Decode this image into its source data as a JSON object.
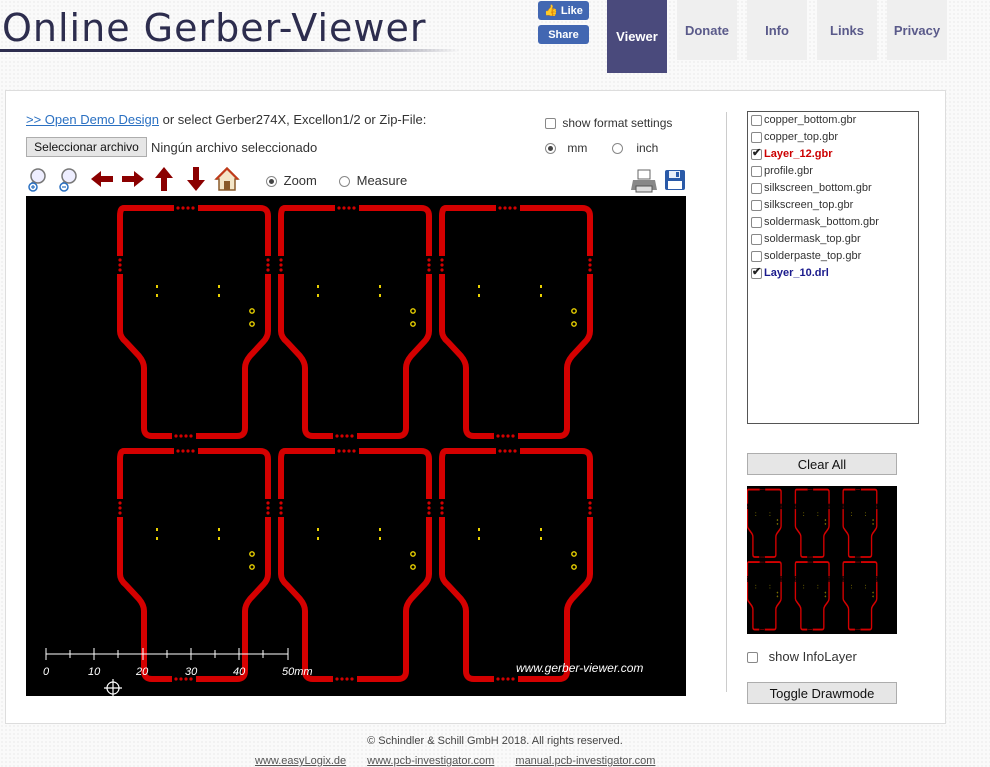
{
  "header": {
    "logo_text": "Online Gerber-Viewer",
    "fb_like": "Like",
    "fb_share": "Share",
    "tabs": [
      "Viewer",
      "Donate",
      "Info",
      "Links",
      "Privacy"
    ]
  },
  "controls": {
    "demo_link": ">> Open Demo Design",
    "select_text": "or select Gerber274X, Excellon1/2 or Zip-File:",
    "file_button": "Seleccionar archivo",
    "file_status": "Ningún archivo seleccionado",
    "show_format": "show format settings",
    "unit_mm": "mm",
    "unit_inch": "inch",
    "mode_zoom": "Zoom",
    "mode_measure": "Measure"
  },
  "canvas": {
    "watermark": "www.gerber-viewer.com",
    "scale_labels": [
      "0",
      "10",
      "20",
      "30",
      "40",
      "50mm"
    ]
  },
  "layers": [
    {
      "name": "copper_bottom.gbr",
      "checked": false
    },
    {
      "name": "copper_top.gbr",
      "checked": false
    },
    {
      "name": "Layer_12.gbr",
      "checked": true
    },
    {
      "name": "profile.gbr",
      "checked": false
    },
    {
      "name": "silkscreen_bottom.gbr",
      "checked": false
    },
    {
      "name": "silkscreen_top.gbr",
      "checked": false
    },
    {
      "name": "soldermask_bottom.gbr",
      "checked": false
    },
    {
      "name": "soldermask_top.gbr",
      "checked": false
    },
    {
      "name": "solderpaste_top.gbr",
      "checked": false
    },
    {
      "name": "Layer_10.drl",
      "checked": true
    }
  ],
  "sidebar": {
    "clear_all": "Clear All",
    "show_infolayer": "show InfoLayer",
    "toggle_drawmode": "Toggle Drawmode"
  },
  "footer": {
    "copyright": "© Schindler & Schill GmbH 2018. All rights reserved.",
    "links": [
      "www.easyLogix.de",
      "www.pcb-investigator.com",
      "manual.pcb-investigator.com"
    ]
  },
  "colors": {
    "accent": "#4a4a7c",
    "trace": "#d40000",
    "layer_12": "#cc0000",
    "layer_10": "#1a1a8c",
    "drill": "#e8d000"
  }
}
